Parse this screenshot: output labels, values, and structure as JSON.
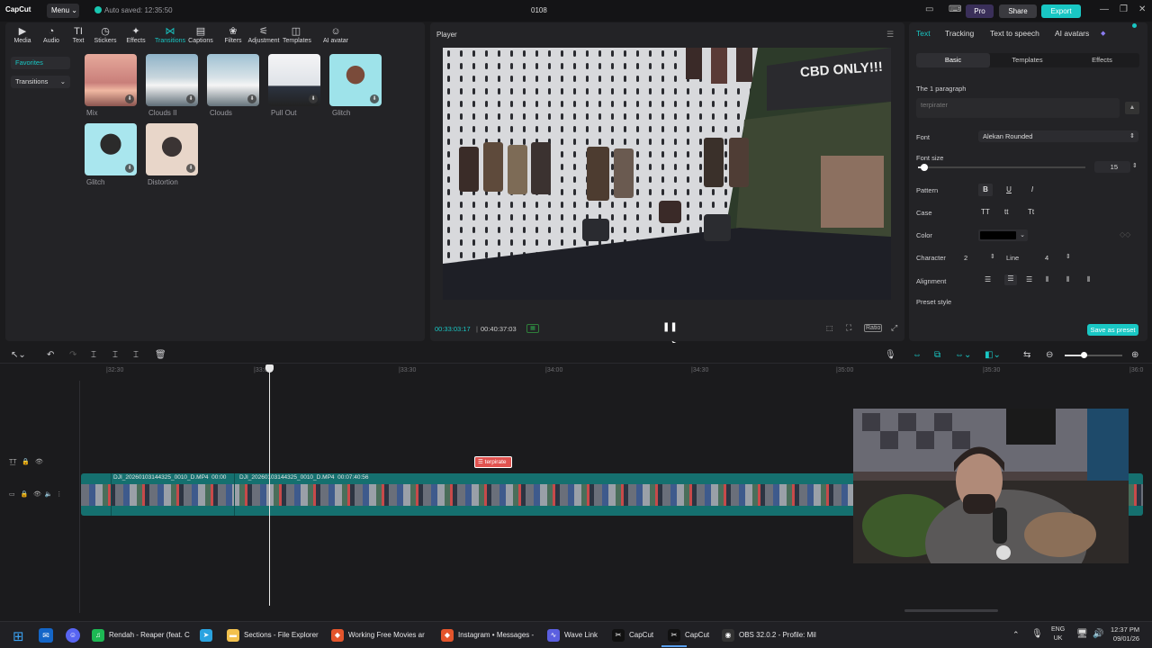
{
  "app": {
    "logo": "CapCut",
    "menu_label": "Menu",
    "autosave": "Auto saved: 12:35:50",
    "project_title": "0108",
    "pro_label": "Pro",
    "share_label": "Share",
    "export_label": "Export"
  },
  "media_toolbar": [
    {
      "label": "Media",
      "icon": "media-icon"
    },
    {
      "label": "Audio",
      "icon": "audio-icon"
    },
    {
      "label": "Text",
      "icon": "text-icon"
    },
    {
      "label": "Stickers",
      "icon": "sticker-icon"
    },
    {
      "label": "Effects",
      "icon": "effects-icon"
    },
    {
      "label": "Transitions",
      "icon": "transitions-icon",
      "active": true
    },
    {
      "label": "Captions",
      "icon": "captions-icon"
    },
    {
      "label": "Filters",
      "icon": "filters-icon"
    },
    {
      "label": "Adjustment",
      "icon": "adjustment-icon"
    },
    {
      "label": "Templates",
      "icon": "templates-icon"
    },
    {
      "label": "AI avatar",
      "icon": "ai-avatar-icon"
    }
  ],
  "sidebar": {
    "favorites": "Favorites",
    "transitions": "Transitions"
  },
  "transitions": [
    {
      "label": "Mix"
    },
    {
      "label": "Clouds II"
    },
    {
      "label": "Clouds"
    },
    {
      "label": "Pull Out"
    },
    {
      "label": "Glitch"
    },
    {
      "label": "Glitch"
    },
    {
      "label": "Distortion"
    }
  ],
  "player": {
    "title": "Player",
    "current_time": "00:33:03:17",
    "total_time": "00:40:37:03",
    "ratio_label": "Ratio",
    "video_sign_text": "CBD ONLY!!!"
  },
  "properties": {
    "tabs": [
      "Text",
      "Tracking",
      "Text to speech",
      "AI avatars"
    ],
    "subtabs": [
      "Basic",
      "Templates",
      "Effects"
    ],
    "paragraph_heading": "The 1 paragraph",
    "text_value": "terpirater",
    "font_label": "Font",
    "font_value": "Alekan Rounded",
    "font_size_label": "Font size",
    "font_size_value": "15",
    "font_size_fraction": 0.04,
    "pattern_label": "Pattern",
    "pattern_buttons": [
      "B",
      "U",
      "I"
    ],
    "case_label": "Case",
    "case_buttons": [
      "TT",
      "tt",
      "Tt"
    ],
    "color_label": "Color",
    "color_value": "#000000",
    "character_label": "Character",
    "character_value": "2",
    "line_label": "Line",
    "line_value": "4",
    "alignment_label": "Alignment",
    "preset_style_label": "Preset style",
    "save_preset_label": "Save as preset"
  },
  "timeline": {
    "ruler": [
      "|32:30",
      "|33:00",
      "|33:30",
      "|34:00",
      "|34:30",
      "|35:00",
      "|35:30",
      "|36:0"
    ],
    "text_clip_label": "terpirate",
    "clip1_label": "DJI_20260103144325_0010_D.MP4",
    "clip1_time": "00:00",
    "clip2_label": "DJI_20260103144325_0010_D.MP4",
    "clip2_time": "00:07:40:56"
  },
  "taskbar": {
    "items": [
      {
        "label": "Rendah - Reaper (feat. C",
        "icon": "spotify-icon",
        "color": "#1db954"
      },
      {
        "label": "",
        "icon": "telegram-icon",
        "color": "#2aa3e0"
      },
      {
        "label": "Sections - File Explorer",
        "icon": "folder-icon",
        "color": "#f2c14e"
      },
      {
        "label": "Working Free Movies ar",
        "icon": "brave-icon",
        "color": "#e4552c"
      },
      {
        "label": "Instagram • Messages -",
        "icon": "brave-icon",
        "color": "#e4552c"
      },
      {
        "label": "Wave Link",
        "icon": "wave-link-icon",
        "color": "#5b5fe0"
      },
      {
        "label": "CapCut",
        "icon": "capcut-icon",
        "color": "#111111"
      },
      {
        "label": "CapCut",
        "icon": "capcut-icon",
        "color": "#111111"
      },
      {
        "label": "OBS 32.0.2 - Profile: Mil",
        "icon": "obs-icon",
        "color": "#333333"
      }
    ],
    "lang": "ENG",
    "region": "UK",
    "time": "12:37 PM",
    "date": "09/01/26"
  },
  "colors": {
    "accent": "#19c7c4",
    "text_clip": "#e0524f",
    "video_track": "#1a8a8a"
  }
}
